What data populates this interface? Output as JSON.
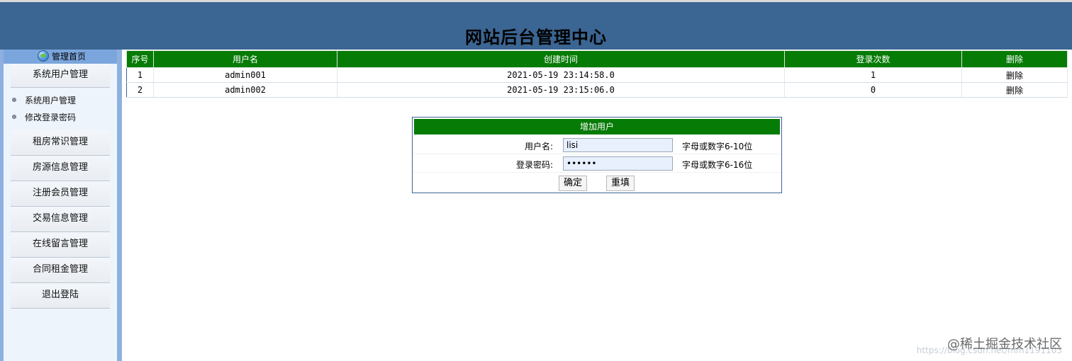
{
  "header": {
    "title": "网站后台管理中心"
  },
  "sidebar": {
    "home_label": "管理首页",
    "menu_system": "系统用户管理",
    "sub_items": [
      "系统用户管理",
      "修改登录密码"
    ],
    "menu_items": [
      "租房常识管理",
      "房源信息管理",
      "注册会员管理",
      "交易信息管理",
      "在线留言管理",
      "合同租金管理",
      "退出登陆"
    ]
  },
  "users_table": {
    "headers": [
      "序号",
      "用户名",
      "创建时间",
      "登录次数",
      "删除"
    ],
    "rows": [
      [
        "1",
        "admin001",
        "2021-05-19 23:14:58.0",
        "1",
        "删除"
      ],
      [
        "2",
        "admin002",
        "2021-05-19 23:15:06.0",
        "0",
        "删除"
      ]
    ]
  },
  "add_user": {
    "title": "增加用户",
    "username_label": "用户名:",
    "username_value": "lisi",
    "username_hint": "字母或数字6-10位",
    "password_label": "登录密码:",
    "password_value": "••••••",
    "password_hint": "字母或数字6-16位",
    "confirm_label": "确定",
    "reset_label": "重填"
  },
  "watermark": {
    "text": "@稀土掘金技术社区",
    "url": "https://blog.csdn.net/mm1191103"
  }
}
